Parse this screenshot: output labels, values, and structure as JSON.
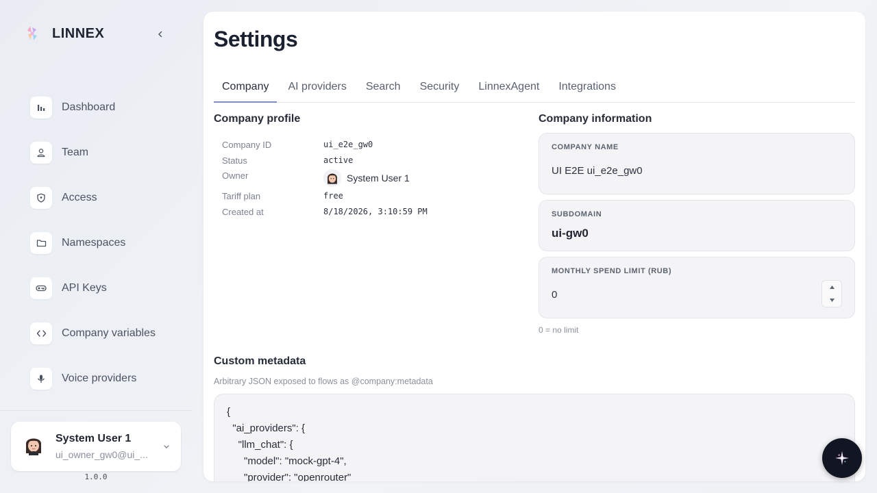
{
  "brand": {
    "name": "LINNEX"
  },
  "nav": {
    "items": [
      {
        "label": "Dashboard",
        "icon": "bar-chart-icon"
      },
      {
        "label": "Team",
        "icon": "user-icon"
      },
      {
        "label": "Access",
        "icon": "shield-icon"
      },
      {
        "label": "Namespaces",
        "icon": "folder-icon"
      },
      {
        "label": "API Keys",
        "icon": "key-icon"
      },
      {
        "label": "Company variables",
        "icon": "code-icon"
      },
      {
        "label": "Voice providers",
        "icon": "microphone-icon"
      }
    ]
  },
  "user": {
    "name": "System User 1",
    "email": "ui_owner_gw0@ui_..."
  },
  "version": "1.0.0",
  "page": {
    "title": "Settings"
  },
  "tabs": [
    {
      "label": "Company",
      "active": true
    },
    {
      "label": "AI providers",
      "active": false
    },
    {
      "label": "Search",
      "active": false
    },
    {
      "label": "Security",
      "active": false
    },
    {
      "label": "LinnexAgent",
      "active": false
    },
    {
      "label": "Integrations",
      "active": false
    }
  ],
  "profile": {
    "title": "Company profile",
    "company_id_label": "Company ID",
    "company_id": "ui_e2e_gw0",
    "status_label": "Status",
    "status": "active",
    "owner_label": "Owner",
    "owner": "System User 1",
    "tariff_label": "Tariff plan",
    "tariff": "free",
    "created_label": "Created at",
    "created": "8/18/2026, 3:10:59 PM"
  },
  "info": {
    "title": "Company information",
    "company_name_label": "COMPANY NAME",
    "company_name": "UI E2E ui_e2e_gw0",
    "subdomain_label": "SUBDOMAIN",
    "subdomain": "ui-gw0",
    "spend_label": "MONTHLY SPEND LIMIT (RUB)",
    "spend": "0",
    "spend_hint": "0 = no limit"
  },
  "metadata": {
    "title": "Custom metadata",
    "subtitle": "Arbitrary JSON exposed to flows as @company:metadata",
    "lines": [
      "{",
      "  \"ai_providers\": {",
      "    \"llm_chat\": {",
      "      \"model\": \"mock-gpt-4\",",
      "      \"provider\": \"openrouter\""
    ]
  },
  "colors": {
    "accent": "#7d8ec7",
    "background": "#eef1f5",
    "panel": "#ffffff"
  }
}
